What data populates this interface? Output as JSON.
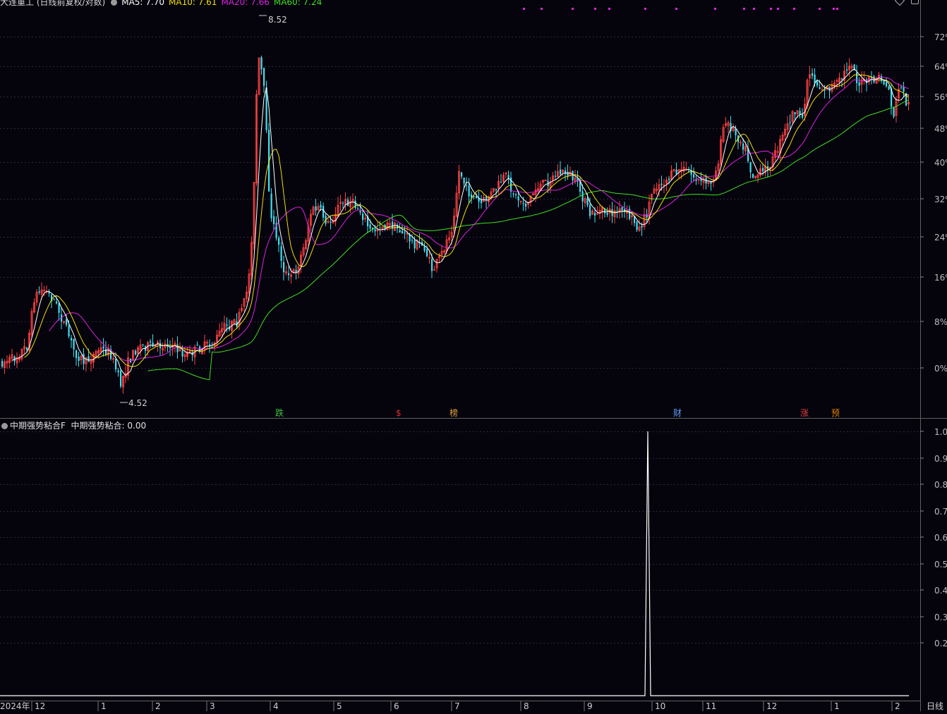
{
  "header": {
    "title": "大连重工 (日线前复权/对数)",
    "ma5": "MA5: 7.70",
    "ma10": "MA10: 7.61",
    "ma20": "MA20: 7.66",
    "ma60": "MA60: 7.24",
    "colors": {
      "title": "#d8d8d8",
      "ma5": "#ffffff",
      "ma10": "#f0e000",
      "ma20": "#e020e0",
      "ma60": "#40e020"
    }
  },
  "main_panel": {
    "pct_axis_labels": [
      "72%",
      "64%",
      "56%",
      "48%",
      "40%",
      "32%",
      "24%",
      "16%",
      "8%",
      "0%"
    ],
    "price_high_label": "8.52",
    "price_low_label": "4.52",
    "event_markers": [
      {
        "label": "跌",
        "color": "#40c040"
      },
      {
        "label": "$",
        "color": "#e03030"
      },
      {
        "label": "榜",
        "color": "#e0a040"
      },
      {
        "label": "财",
        "color": "#60a0ff"
      },
      {
        "label": "涨",
        "color": "#e04040"
      },
      {
        "label": "预",
        "color": "#e08000"
      }
    ],
    "icons": [
      "diamond-icon",
      "lock-icon"
    ]
  },
  "indicator_panel": {
    "name": "中期强势粘合F",
    "value_label": "中期强势粘合: 0.00",
    "axis_labels": [
      "1.0",
      "0.9",
      "0.8",
      "0.7",
      "0.6",
      "0.5",
      "0.4",
      "0.3",
      "0.2"
    ]
  },
  "x_axis": {
    "labels": [
      "2024年",
      "12",
      "1",
      "2",
      "3",
      "4",
      "5",
      "6",
      "7",
      "8",
      "9",
      "10",
      "11",
      "12",
      "1",
      "2"
    ],
    "period_label": "日线"
  },
  "chart_data": {
    "type": "candlestick",
    "title": "大连重工 (日线前复权/对数)",
    "price_range": [
      4.52,
      8.52
    ],
    "moving_averages": {
      "MA5": 7.7,
      "MA10": 7.61,
      "MA20": 7.66,
      "MA60": 7.24
    },
    "indicator": {
      "name": "中期强势粘合",
      "current": 0.0,
      "spike_value": 1.0,
      "spike_near": "10"
    }
  }
}
